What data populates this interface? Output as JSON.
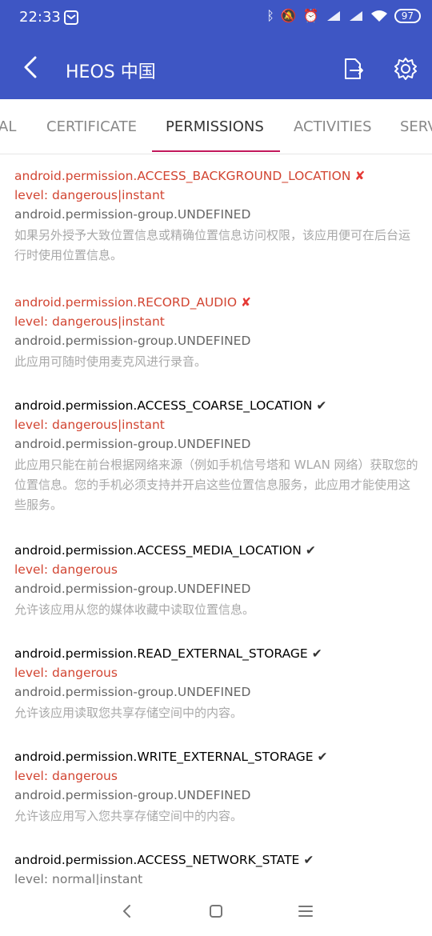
{
  "status_bar": {
    "time": "22:33",
    "battery": "97",
    "icons": [
      "mail-icon",
      "bluetooth-icon",
      "mute-icon",
      "alarm-icon",
      "signal-icon",
      "hd-signal-icon",
      "wifi-icon",
      "battery-icon"
    ]
  },
  "app_bar": {
    "title": "HEOS 中国",
    "icons": [
      "back-arrow-icon",
      "export-icon",
      "settings-gear-icon"
    ]
  },
  "tabs": [
    {
      "label": "AL",
      "active": false
    },
    {
      "label": "CERTIFICATE",
      "active": false
    },
    {
      "label": "PERMISSIONS",
      "active": true
    },
    {
      "label": "ACTIVITIES",
      "active": false
    },
    {
      "label": "SERV",
      "active": false
    }
  ],
  "permissions": [
    {
      "name": "android.permission.ACCESS_BACKGROUND_LOCATION",
      "granted": false,
      "mark": "✘",
      "level": "level: dangerous|instant",
      "group": "android.permission-group.UNDEFINED",
      "description": "如果另外授予大致位置信息或精确位置信息访问权限，该应用便可在后台运行时使用位置信息。"
    },
    {
      "name": "android.permission.RECORD_AUDIO",
      "granted": false,
      "mark": "✘",
      "level": "level: dangerous|instant",
      "group": "android.permission-group.UNDEFINED",
      "description": "此应用可随时使用麦克风进行录音。"
    },
    {
      "name": "android.permission.ACCESS_COARSE_LOCATION",
      "granted": true,
      "mark": "✔",
      "level": "level: dangerous|instant",
      "group": "android.permission-group.UNDEFINED",
      "description": "此应用只能在前台根据网络来源（例如手机信号塔和 WLAN 网络）获取您的位置信息。您的手机必须支持并开启这些位置信息服务，此应用才能使用这些服务。"
    },
    {
      "name": "android.permission.ACCESS_MEDIA_LOCATION",
      "granted": true,
      "mark": "✔",
      "level": "level: dangerous",
      "group": "android.permission-group.UNDEFINED",
      "description": "允许该应用从您的媒体收藏中读取位置信息。"
    },
    {
      "name": "android.permission.READ_EXTERNAL_STORAGE",
      "granted": true,
      "mark": "✔",
      "level": "level: dangerous",
      "group": "android.permission-group.UNDEFINED",
      "description": "允许该应用读取您共享存储空间中的内容。"
    },
    {
      "name": "android.permission.WRITE_EXTERNAL_STORAGE",
      "granted": true,
      "mark": "✔",
      "level": "level: dangerous",
      "group": "android.permission-group.UNDEFINED",
      "description": "允许该应用写入您共享存储空间中的内容。"
    },
    {
      "name": "android.permission.ACCESS_NETWORK_STATE",
      "granted": true,
      "mark": "✔",
      "level": "level: normal|instant",
      "group": "",
      "description": ""
    }
  ],
  "colors": {
    "app_bar": "#3e56c4",
    "danger": "#d24532",
    "tab_indicator": "#c2185b"
  }
}
